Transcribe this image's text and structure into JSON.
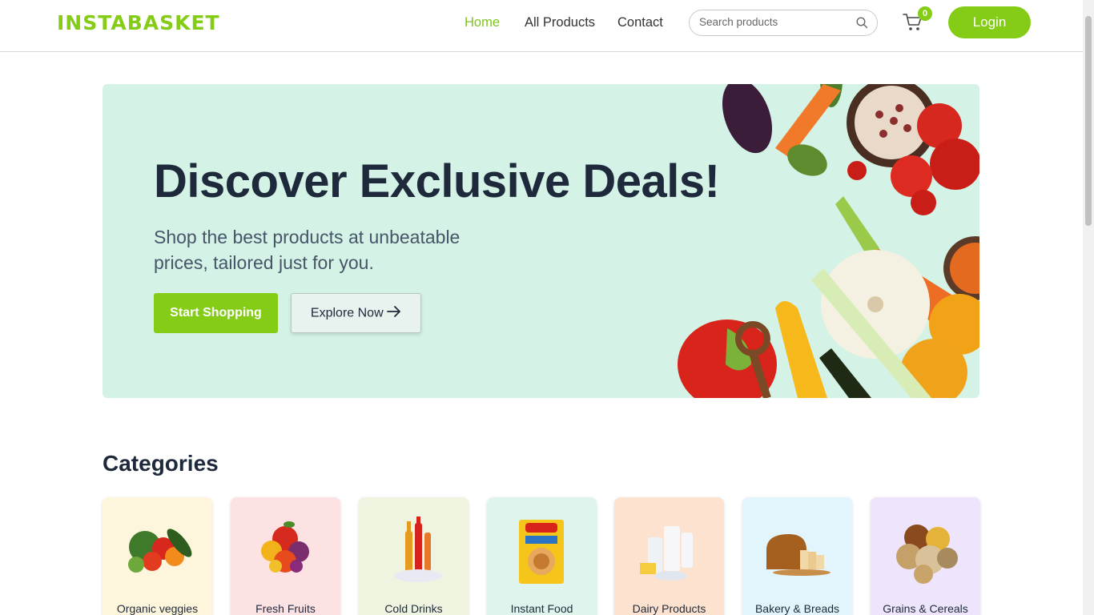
{
  "header": {
    "logo": "INSTABASKET",
    "nav": [
      {
        "label": "Home"
      },
      {
        "label": "All Products"
      },
      {
        "label": "Contact"
      }
    ],
    "search": {
      "placeholder": "Search products",
      "value": ""
    },
    "cart": {
      "count": "0"
    },
    "login_label": "Login"
  },
  "hero": {
    "title": "Discover Exclusive Deals!",
    "subtitle": "Shop the best products at unbeatable prices, tailored just for you.",
    "primary_button": "Start Shopping",
    "secondary_button": "Explore Now",
    "secondary_icon": "arrow-right-icon"
  },
  "categories": {
    "title": "Categories",
    "items": [
      {
        "label": "Organic veggies",
        "bg": "#fdf6dc",
        "icon": "vegetables-icon"
      },
      {
        "label": "Fresh Fruits",
        "bg": "#fde2e4",
        "icon": "fruits-icon"
      },
      {
        "label": "Cold Drinks",
        "bg": "#eef4df",
        "icon": "drinks-icon"
      },
      {
        "label": "Instant Food",
        "bg": "#dff4ec",
        "icon": "noodles-icon"
      },
      {
        "label": "Dairy Products",
        "bg": "#fde3cf",
        "icon": "dairy-icon"
      },
      {
        "label": "Bakery & Breads",
        "bg": "#e2f5fc",
        "icon": "bread-icon"
      },
      {
        "label": "Grains & Cereals",
        "bg": "#eee4fb",
        "icon": "grains-icon"
      }
    ]
  },
  "colors": {
    "brand": "#84cc16",
    "hero_bg": "#d4f2e5",
    "text_dark": "#1e293b"
  }
}
